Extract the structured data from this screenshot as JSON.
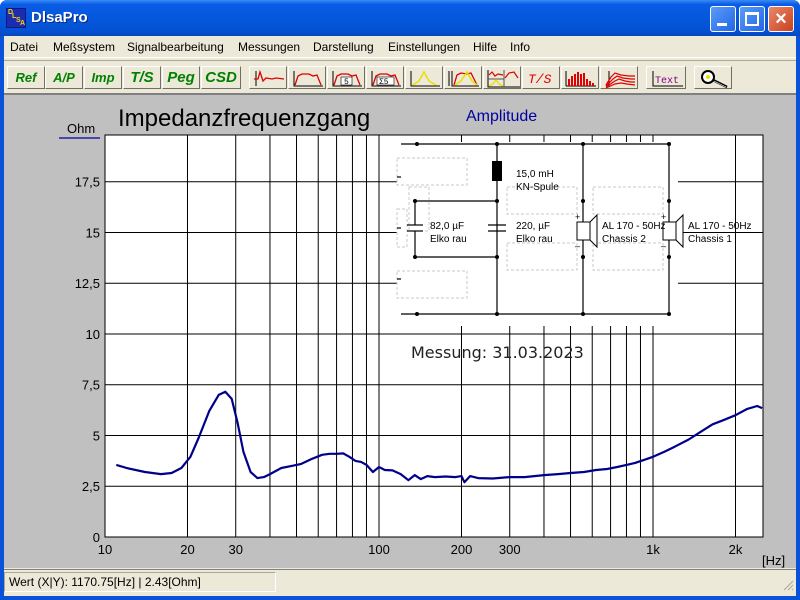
{
  "window": {
    "title": "DlsaPro",
    "icon_text": [
      "D",
      "L",
      "S",
      "A"
    ],
    "buttons": {
      "minimize": "minimize",
      "maximize": "maximize",
      "close": "×"
    }
  },
  "menu": {
    "items": [
      {
        "label": "Datei"
      },
      {
        "label": "Meßsystem"
      },
      {
        "label": "Signalbearbeitung"
      },
      {
        "label": "Messungen"
      },
      {
        "label": "Darstellung"
      },
      {
        "label": "Einstellungen"
      },
      {
        "label": "Hilfe"
      },
      {
        "label": "Info"
      }
    ]
  },
  "toolbar": {
    "text_buttons": [
      {
        "label": "Ref"
      },
      {
        "label": "A/P"
      },
      {
        "label": "Imp"
      },
      {
        "label": "T/S"
      },
      {
        "label": "Peg"
      },
      {
        "label": "CSD"
      }
    ],
    "icon_buttons": [
      {
        "name": "impulse-response-icon"
      },
      {
        "name": "frequency-response-icon"
      },
      {
        "name": "frequency-response-5-icon"
      },
      {
        "name": "frequency-response-sum5-icon"
      },
      {
        "name": "filter-curve-icon"
      },
      {
        "name": "multi-filter-curve-icon"
      },
      {
        "name": "compare-curves-icon"
      },
      {
        "name": "ts-parameters-icon",
        "label": "T/S"
      },
      {
        "name": "bar-spectrum-icon"
      },
      {
        "name": "waterfall-icon"
      },
      {
        "name": "text-tool-icon",
        "label": "Text"
      },
      {
        "name": "zoom-magnifier-icon"
      }
    ]
  },
  "graph": {
    "title": "Impedanzfrequenzgang",
    "mode_label": "Amplitude",
    "y_unit": "Ohm",
    "x_unit": "[Hz]",
    "measurement_note": "Messung: 31.03.2023",
    "curve_color": "#00008b",
    "schematic": {
      "inductor": {
        "value": "15,0 mH",
        "type": "KN-Spule"
      },
      "capacitor1": {
        "value": "82,0 µF",
        "type": "Elko rau"
      },
      "capacitor2": {
        "value": "220, µF",
        "type": "Elko rau"
      },
      "driver2": {
        "model": "AL 170 - 50Hz",
        "name": "Chassis 2"
      },
      "driver1": {
        "model": "AL 170 - 50Hz",
        "name": "Chassis 1"
      }
    }
  },
  "chart_data": {
    "type": "line",
    "title": "Impedanzfrequenzgang",
    "subtitle": "Amplitude",
    "xlabel": "[Hz]",
    "ylabel": "Ohm",
    "xscale": "log",
    "xlim": [
      10,
      2520
    ],
    "ylim": [
      0,
      19.8
    ],
    "grid": true,
    "xticks": [
      {
        "v": 10,
        "label": "10"
      },
      {
        "v": 20,
        "label": "20"
      },
      {
        "v": 30,
        "label": "30"
      },
      {
        "v": 100,
        "label": "100"
      },
      {
        "v": 200,
        "label": "200"
      },
      {
        "v": 300,
        "label": "300"
      },
      {
        "v": 1000,
        "label": "1k"
      },
      {
        "v": 2000,
        "label": "2k"
      }
    ],
    "yticks": [
      {
        "v": 0,
        "label": "0"
      },
      {
        "v": 2.5,
        "label": "2,5"
      },
      {
        "v": 5,
        "label": "5"
      },
      {
        "v": 7.5,
        "label": "7,5"
      },
      {
        "v": 10,
        "label": "10"
      },
      {
        "v": 12.5,
        "label": "12,5"
      },
      {
        "v": 15,
        "label": "15"
      },
      {
        "v": 17.5,
        "label": "17,5"
      }
    ],
    "series": [
      {
        "name": "Impedanz",
        "x": [
          11,
          12,
          14,
          16,
          17.5,
          19,
          20.5,
          22,
          24,
          26,
          27.5,
          29,
          30.5,
          32,
          34,
          36,
          38,
          40,
          44,
          48,
          52,
          57,
          62,
          66,
          70,
          74,
          78,
          82,
          86,
          90,
          95,
          100,
          105,
          112,
          120,
          128,
          135,
          142,
          150,
          160,
          175,
          190,
          200,
          205,
          215,
          230,
          260,
          300,
          340,
          400,
          450,
          500,
          560,
          620,
          680,
          740,
          800,
          860,
          930,
          1000,
          1100,
          1200,
          1350,
          1500,
          1650,
          1800,
          2000,
          2200,
          2400,
          2500
        ],
        "y": [
          3.55,
          3.4,
          3.2,
          3.1,
          3.15,
          3.4,
          3.95,
          4.9,
          6.2,
          7.0,
          7.15,
          6.8,
          5.6,
          4.2,
          3.2,
          2.9,
          2.95,
          3.1,
          3.4,
          3.5,
          3.6,
          3.85,
          4.05,
          4.1,
          4.1,
          4.12,
          3.95,
          3.75,
          3.7,
          3.55,
          3.2,
          3.45,
          3.3,
          3.28,
          3.1,
          2.8,
          3.05,
          2.85,
          3.0,
          2.95,
          2.98,
          2.95,
          3.0,
          2.7,
          3.0,
          2.9,
          2.88,
          2.95,
          2.95,
          3.05,
          3.1,
          3.15,
          3.2,
          3.3,
          3.35,
          3.45,
          3.55,
          3.65,
          3.8,
          3.95,
          4.2,
          4.45,
          4.8,
          5.2,
          5.55,
          5.75,
          6.0,
          6.3,
          6.45,
          6.35
        ]
      }
    ]
  },
  "status": {
    "readout": "Wert (X|Y): 1170.75[Hz] | 2.43[Ohm]"
  }
}
